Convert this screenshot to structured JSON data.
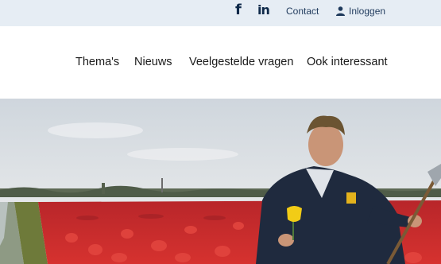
{
  "topbar": {
    "facebook_icon": "facebook-icon",
    "linkedin_icon": "linkedin-icon",
    "contact_label": "Contact",
    "login_label": "Inloggen",
    "login_icon": "user-icon",
    "background": "#e6edf4",
    "text_color": "#1f3a5c"
  },
  "nav": {
    "items": [
      {
        "label": "Thema's"
      },
      {
        "label": "Nieuws"
      },
      {
        "label": "Veelgestelde vragen"
      },
      {
        "label": "Ook interessant"
      }
    ]
  },
  "hero": {
    "image": "tulip-field-farmer-photo"
  }
}
